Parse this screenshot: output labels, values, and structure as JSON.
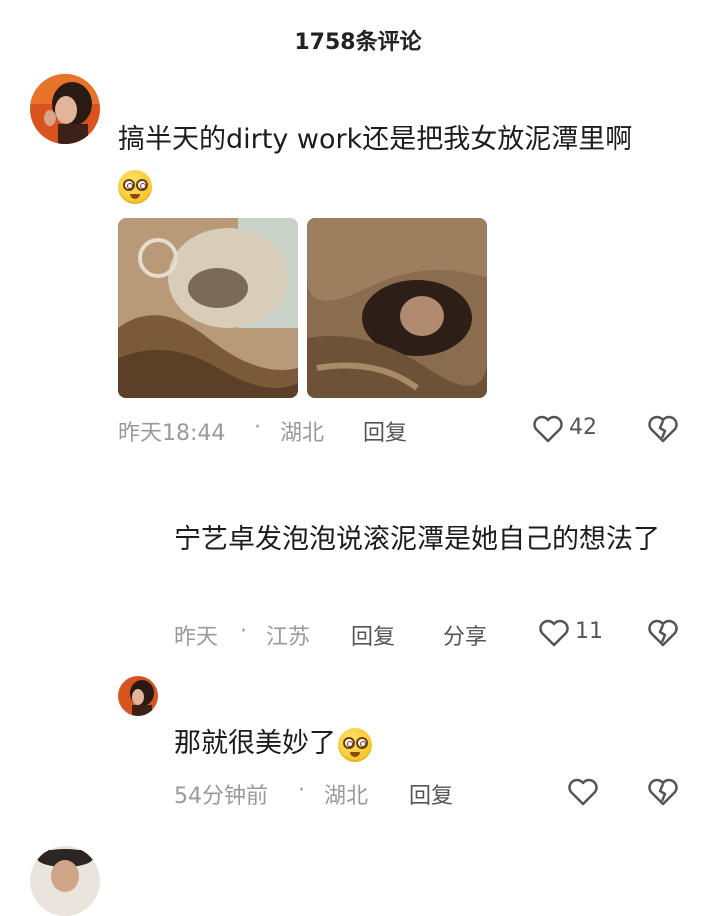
{
  "header": {
    "title": "1758条评论"
  },
  "comments": [
    {
      "text": "搞半天的dirty work还是把我女放泥潭里啊",
      "emoji": "dizzy-face-emoji",
      "time": "昨天18:44",
      "location": "湖北",
      "reply_label": "回复",
      "like_count": "42"
    },
    {
      "text": "宁艺卓发泡泡说滚泥潭是她自己的想法了",
      "time": "昨天",
      "location": "江苏",
      "reply_label": "回复",
      "share_label": "分享",
      "like_count": "11"
    },
    {
      "text": "那就很美妙了",
      "emoji": "dizzy-face-emoji",
      "time": "54分钟前",
      "location": "湖北",
      "reply_label": "回复"
    }
  ],
  "separator": "·",
  "colors": {
    "meta_gray": "#9a9a9a",
    "text_dark": "#1c1c1c"
  }
}
